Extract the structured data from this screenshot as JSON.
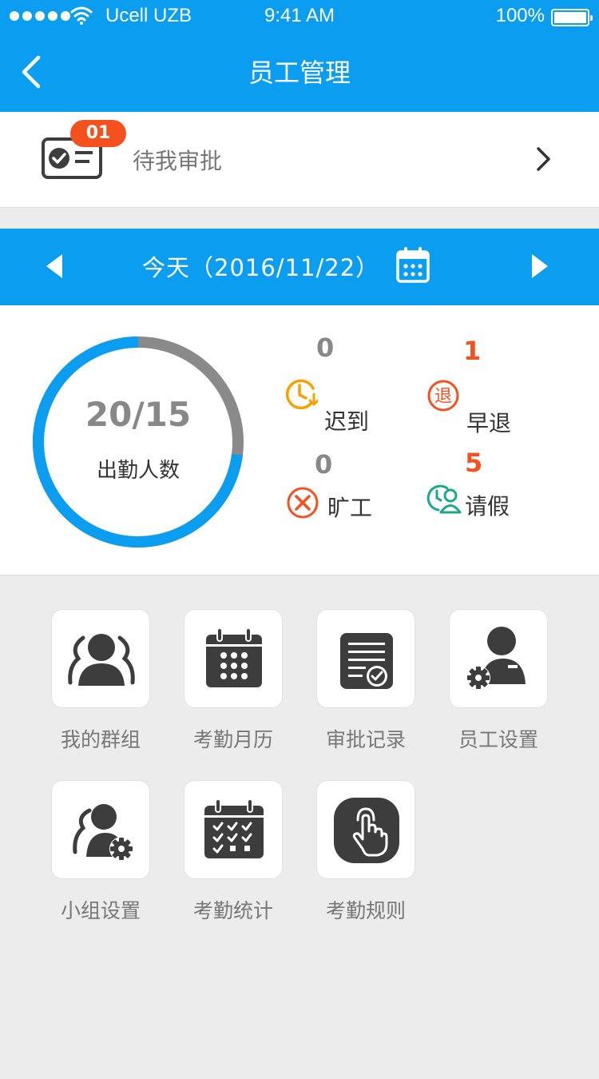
{
  "status_bar": {
    "carrier": "Ucell UZB",
    "time": "9:41 AM",
    "battery": "100%",
    "signal_dots": 5
  },
  "header": {
    "title": "员工管理",
    "back_icon": "chevron-left-icon"
  },
  "pending": {
    "badge": "01",
    "label": "待我审批",
    "icon": "approval-card-icon"
  },
  "date_bar": {
    "text": "今天（2016/11/22）",
    "prev_icon": "triangle-left-icon",
    "next_icon": "triangle-right-icon",
    "calendar_icon": "calendar-icon"
  },
  "attendance": {
    "ratio": "20/15",
    "label": "出勤人数",
    "ring_fill_fraction": 0.73,
    "ring_colors": {
      "filled": "#0b9ef0",
      "remaining": "#8a8a8a"
    },
    "stats": [
      {
        "key": "late",
        "value": "0",
        "label": "迟到",
        "icon": "clock-late-icon",
        "value_color": "#888888",
        "icon_color": "#f5a200"
      },
      {
        "key": "early",
        "value": "1",
        "label": "早退",
        "icon": "early-leave-icon",
        "value_color": "#f4511e",
        "icon_color": "#f4511e"
      },
      {
        "key": "absent",
        "value": "0",
        "label": "旷工",
        "icon": "absent-x-icon",
        "value_color": "#888888",
        "icon_color": "#f4511e"
      },
      {
        "key": "leave",
        "value": "5",
        "label": "请假",
        "icon": "leave-person-icon",
        "value_color": "#f4511e",
        "icon_color": "#1aa98a"
      }
    ]
  },
  "grid": {
    "items": [
      {
        "label": "我的群组",
        "icon": "group-icon"
      },
      {
        "label": "考勤月历",
        "icon": "calendar-month-icon"
      },
      {
        "label": "审批记录",
        "icon": "approval-record-icon"
      },
      {
        "label": "员工设置",
        "icon": "employee-settings-icon"
      },
      {
        "label": "小组设置",
        "icon": "group-settings-icon"
      },
      {
        "label": "考勤统计",
        "icon": "attendance-stats-icon"
      },
      {
        "label": "考勤规则",
        "icon": "attendance-rules-icon"
      }
    ]
  },
  "colors": {
    "primary": "#0b9ef0",
    "accent": "#f4511e",
    "icon_dark": "#3d3d3d",
    "background": "#ececec"
  }
}
